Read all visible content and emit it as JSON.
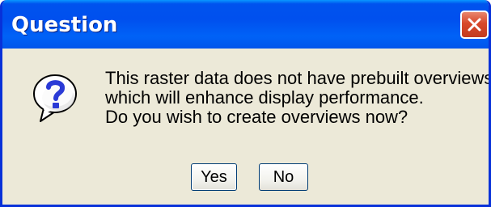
{
  "window": {
    "title": "Question",
    "close_icon": "close-icon"
  },
  "message": {
    "icon": "question-icon",
    "lines": [
      "This raster data does not have prebuilt overviews",
      "which will enhance display performance.",
      "Do you wish to create overviews now?"
    ]
  },
  "buttons": {
    "yes_label": "Yes",
    "no_label": "No"
  },
  "colors": {
    "titlebar": "#0053ee",
    "close_button": "#d8482b",
    "dialog_background": "#ece9d8",
    "frame_border": "#0831d9"
  }
}
